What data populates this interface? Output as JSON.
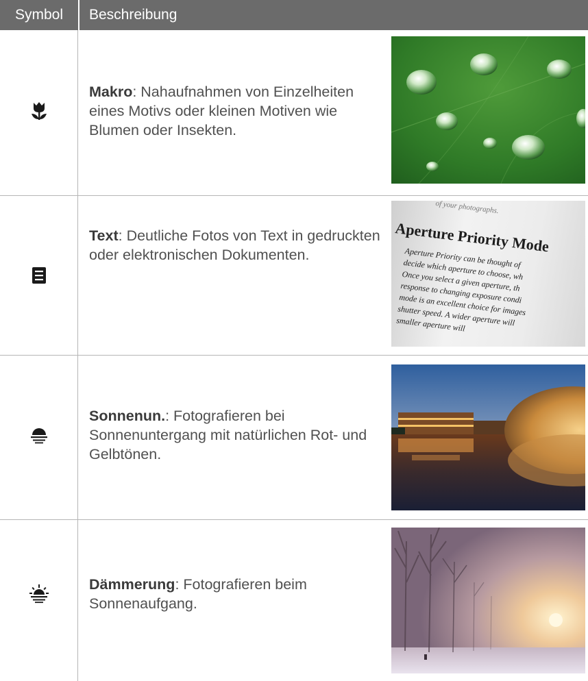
{
  "header": {
    "symbol": "Symbol",
    "description": "Beschreibung"
  },
  "rows": [
    {
      "icon": "macro-flower-icon",
      "title": "Makro",
      "text": ": Nahaufnahmen von Einzelheiten eines Motivs oder kleinen Motiven wie Blumen oder Insekten.",
      "photo": "water-drops-on-leaf-photo"
    },
    {
      "icon": "text-document-icon",
      "title": "Text",
      "text": ": Deutliche Fotos von Text in gedruckten oder elektronischen Dokumenten.",
      "photo": "printed-text-page-photo",
      "photo_text": {
        "top": "of your photographs.",
        "heading": "Aperture Priority Mode",
        "lines": [
          "Aperture Priority can be thought of",
          "decide which aperture to choose, wh",
          "Once you select a given aperture, th",
          "response to changing exposure condi",
          "mode is an excellent choice for images",
          "shutter speed. A wider aperture will",
          "smaller aperture will"
        ]
      }
    },
    {
      "icon": "sunset-icon",
      "title": "Sonnenun.",
      "text": ": Fotografieren bei Sonnenuntergang mit natürlichen Rot- und Gelbtönen.",
      "photo": "city-sunset-reflection-photo"
    },
    {
      "icon": "dawn-icon",
      "title": "Dämmerung",
      "text": ": Fotografieren beim Sonnenaufgang.",
      "photo": "misty-sunrise-forest-photo"
    }
  ],
  "colors": {
    "header_bg": "#6b6b6b",
    "grid_line": "#b5b5b5",
    "text": "#505050"
  }
}
